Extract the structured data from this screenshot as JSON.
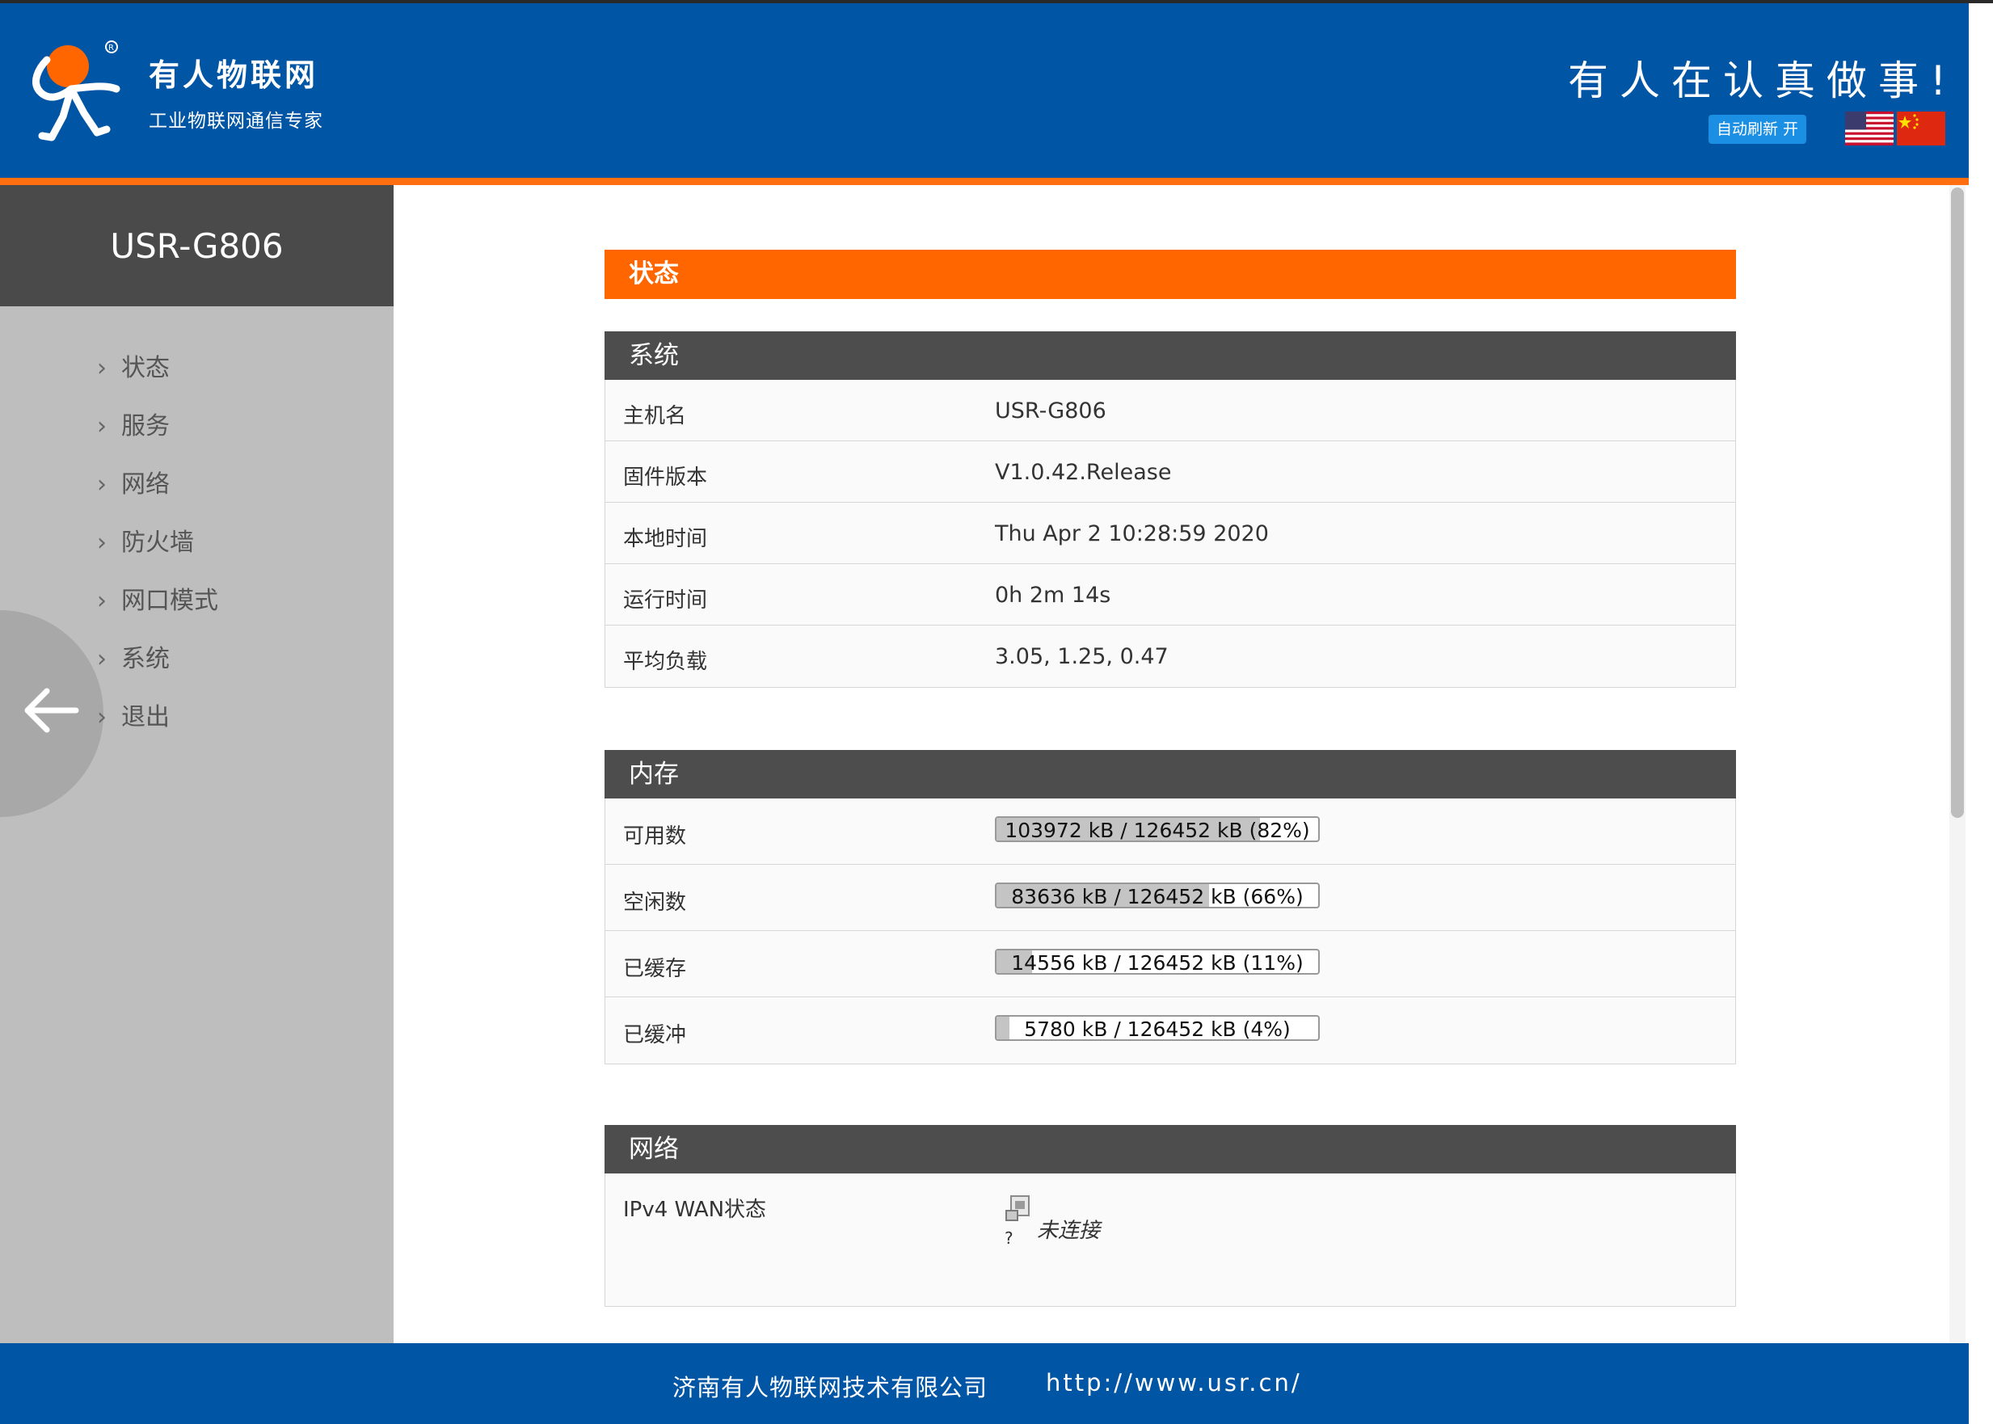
{
  "header": {
    "brand_name": "有人物联网",
    "brand_tag": "工业物联网通信专家",
    "slogan": "有人在认真做事!",
    "auto_refresh": "自动刷新 开",
    "languages": [
      "English",
      "中文"
    ],
    "colors": {
      "header_bg": "#0055a5",
      "accent": "#ff6600"
    }
  },
  "sidebar": {
    "title": "USR-G806",
    "items": [
      {
        "label": "状态"
      },
      {
        "label": "服务"
      },
      {
        "label": "网络"
      },
      {
        "label": "防火墙"
      },
      {
        "label": "网口模式"
      },
      {
        "label": "系统"
      },
      {
        "label": "退出"
      }
    ]
  },
  "main": {
    "page_title": "状态",
    "system": {
      "heading": "系统",
      "rows": [
        {
          "key": "主机名",
          "value": "USR-G806"
        },
        {
          "key": "固件版本",
          "value": "V1.0.42.Release"
        },
        {
          "key": "本地时间",
          "value": "Thu Apr 2 10:28:59 2020"
        },
        {
          "key": "运行时间",
          "value": "0h 2m 14s"
        },
        {
          "key": "平均负载",
          "value": "3.05, 1.25, 0.47"
        }
      ]
    },
    "memory": {
      "heading": "内存",
      "rows": [
        {
          "key": "可用数",
          "value": "103972 kB / 126452 kB (82%)",
          "fraction": 0.82
        },
        {
          "key": "空闲数",
          "value": "83636 kB / 126452 kB (66%)",
          "fraction": 0.66
        },
        {
          "key": "已缓存",
          "value": "14556 kB / 126452 kB (11%)",
          "fraction": 0.11
        },
        {
          "key": "已缓冲",
          "value": "5780 kB / 126452 kB (4%)",
          "fraction": 0.04
        }
      ]
    },
    "network": {
      "heading": "网络",
      "rows": [
        {
          "key": "IPv4 WAN状态",
          "icon_caption": "?",
          "status": "未连接"
        }
      ]
    }
  },
  "footer": {
    "company": "济南有人物联网技术有限公司",
    "url": "http://www.usr.cn/"
  }
}
